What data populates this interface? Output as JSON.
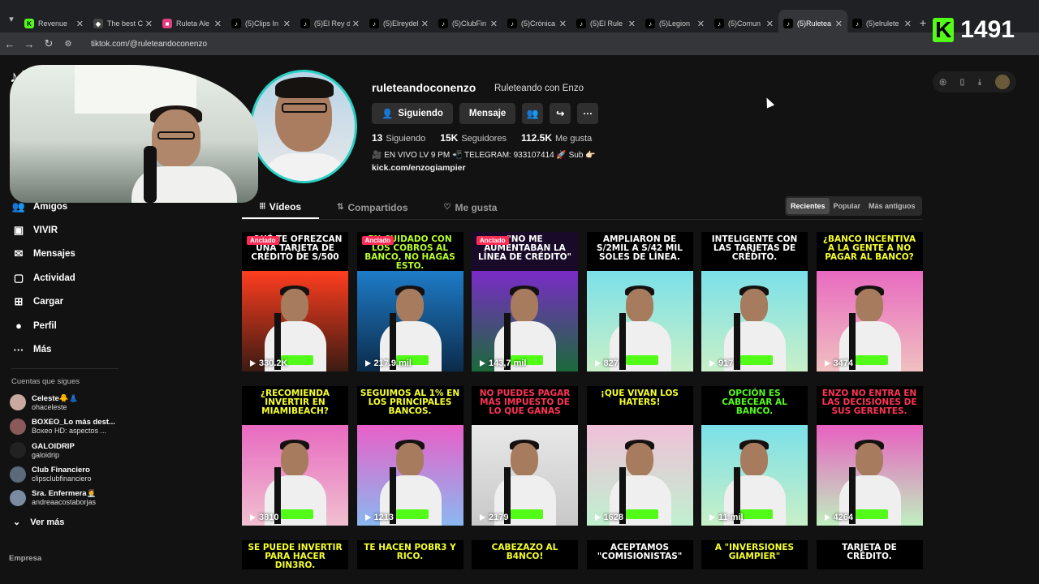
{
  "browser": {
    "tabs": [
      {
        "title": "Revenue",
        "fav_color": "#53fc18",
        "fav_text": "K",
        "active": false
      },
      {
        "title": "The best C",
        "fav_color": "#444",
        "fav_text": "◆",
        "active": false
      },
      {
        "title": "Ruleta Ale",
        "fav_color": "#e04080",
        "fav_text": "■",
        "active": false
      },
      {
        "title": "(5)Clips In",
        "fav_color": "#000",
        "fav_text": "♪",
        "active": false
      },
      {
        "title": "(5)El Rey d",
        "fav_color": "#000",
        "fav_text": "♪",
        "active": false
      },
      {
        "title": "(5)Elreydel",
        "fav_color": "#000",
        "fav_text": "♪",
        "active": false
      },
      {
        "title": "(5)ClubFin",
        "fav_color": "#000",
        "fav_text": "♪",
        "active": false
      },
      {
        "title": "(5)Crónica",
        "fav_color": "#000",
        "fav_text": "♪",
        "active": false
      },
      {
        "title": "(5)El Rule",
        "fav_color": "#000",
        "fav_text": "♪",
        "active": false
      },
      {
        "title": "(5)Legion",
        "fav_color": "#000",
        "fav_text": "♪",
        "active": false
      },
      {
        "title": "(5)Comun",
        "fav_color": "#000",
        "fav_text": "♪",
        "active": false
      },
      {
        "title": "(5)Ruletea",
        "fav_color": "#000",
        "fav_text": "♪",
        "active": true
      },
      {
        "title": "(5)elrulete",
        "fav_color": "#000",
        "fav_text": "♪",
        "active": false
      }
    ],
    "url": "tiktok.com/@ruleteandoconenzo"
  },
  "overlay": {
    "kick_letter": "K",
    "kick_count": "1491"
  },
  "sidebar": {
    "logo": "♪ T",
    "nav": [
      {
        "label": "Amigos",
        "icon": "👥"
      },
      {
        "label": "VIVIR",
        "icon": "▣"
      },
      {
        "label": "Mensajes",
        "icon": "✉"
      },
      {
        "label": "Actividad",
        "icon": "▢"
      },
      {
        "label": "Cargar",
        "icon": "⊞"
      },
      {
        "label": "Perfil",
        "icon": "●"
      },
      {
        "label": "Más",
        "icon": "···"
      }
    ],
    "following_title": "Cuentas que sigues",
    "following": [
      {
        "name": "Celeste🐥👗",
        "handle": "ohaceleste",
        "color": "#c9a9a0"
      },
      {
        "name": "BOXEO_Lo más dest...",
        "handle": "Boxeo HD: aspectos ...",
        "color": "#8a5a5a"
      },
      {
        "name": "GALOIDRIP",
        "handle": "galoidrip",
        "color": "#222"
      },
      {
        "name": "Club Financiero",
        "handle": "clipsclubfinanciero",
        "color": "#5a6a7a"
      },
      {
        "name": "Sra. Enfermera👩‍⚕️",
        "handle": "andreaacostaborjas",
        "color": "#7a8aa0"
      }
    ],
    "see_more": "Ver más",
    "footer": "Empresa"
  },
  "profile": {
    "username": "ruleteandoconenzo",
    "nickname": "Ruleteando con Enzo",
    "buttons": {
      "following": "Siguiendo",
      "message": "Mensaje"
    },
    "stats": [
      {
        "value": "13",
        "label": "Siguiendo"
      },
      {
        "value": "15K",
        "label": "Seguidores"
      },
      {
        "value": "112.5K",
        "label": "Me gusta"
      }
    ],
    "bio": "🎥 EN VIVO LV 9 PM 📲 TELEGRAM: 933107414 🚀 Sub 👉🏻",
    "link": "kick.com/enzogiampier"
  },
  "content_tabs": [
    {
      "label": "Vídeos",
      "icon": "⦙⦙⦙",
      "active": true
    },
    {
      "label": "Compartidos",
      "icon": "⇅",
      "active": false
    },
    {
      "label": "Me gusta",
      "icon": "♡",
      "active": false
    }
  ],
  "sort_options": [
    {
      "label": "Recientes",
      "active": true
    },
    {
      "label": "Popular",
      "active": false
    },
    {
      "label": "Más antiguos",
      "active": false
    }
  ],
  "pinned_label": "Anclado",
  "videos": [
    {
      "caption": "¿Qué te ofrezcan una tarjeta de crédito de S/500",
      "views": "330.2K",
      "pinned": true,
      "cap_bg": "#000",
      "cap_color": "#fff",
      "scene_bg": "linear-gradient(180deg,#ff3d1f,#3b1b12)"
    },
    {
      "caption": "En cuidado con los cobros al banco, no hagas esto.",
      "views": "217.9 mil",
      "pinned": true,
      "cap_bg": "#000",
      "cap_color": "#b6ff2a",
      "scene_bg": "linear-gradient(180deg,#1e7cc8,#0b2b4a)"
    },
    {
      "caption": "\"No me aumentaban la línea de crédito\"",
      "views": "143,7 mil",
      "pinned": true,
      "cap_bg": "#1a0a2a",
      "cap_color": "#fff",
      "scene_bg": "linear-gradient(180deg,#7a2bc8,#1b6a3a)"
    },
    {
      "caption": "Ampliaron de S/2mil a S/42 mil soles de línea.",
      "views": "827",
      "pinned": false,
      "cap_bg": "#000",
      "cap_color": "#fff",
      "scene_bg": "linear-gradient(180deg,#7be0e8,#c8f0c8)"
    },
    {
      "caption": "Inteligente con las tarjetas de crédito.",
      "views": "917",
      "pinned": false,
      "cap_bg": "#000",
      "cap_color": "#fff",
      "scene_bg": "linear-gradient(180deg,#7be0e8,#c8f0c8)"
    },
    {
      "caption": "¿Banco incentiva a la gente a no pagar al banco?",
      "views": "3474",
      "pinned": false,
      "cap_bg": "#000",
      "cap_color": "#f5ff2a",
      "scene_bg": "linear-gradient(180deg,#e86ac0,#f0c0c0)"
    },
    {
      "caption": "¿Recomienda invertir en Miamibeach?",
      "views": "3810",
      "pinned": false,
      "cap_bg": "#000",
      "cap_color": "#f5ff2a",
      "scene_bg": "linear-gradient(180deg,#e86ac0,#f0c0d0)"
    },
    {
      "caption": "Seguimos al 1% en los principales bancos.",
      "views": "1213",
      "pinned": false,
      "cap_bg": "#000",
      "cap_color": "#f5ff2a",
      "scene_bg": "linear-gradient(180deg,#e860c8,#8ab8f0)"
    },
    {
      "caption": "No puedes pagar más impuesto de lo que ganas",
      "views": "2179",
      "pinned": false,
      "cap_bg": "#000",
      "cap_color": "#ff3355",
      "scene_bg": "linear-gradient(180deg,#e8e8e8,#c8c8c8)"
    },
    {
      "caption": "¡Que vivan los haters!",
      "views": "1628",
      "pinned": false,
      "cap_bg": "#000",
      "cap_color": "#f5ff2a",
      "scene_bg": "linear-gradient(180deg,#f0c0d8,#c0f0d0)"
    },
    {
      "caption": "Opción es cabecear al banco.",
      "views": "11 mil",
      "pinned": false,
      "cap_bg": "#000",
      "cap_color": "#53fc18",
      "scene_bg": "linear-gradient(180deg,#7be0e8,#c8f0c8)"
    },
    {
      "caption": "Enzo no entra en las decisiones de sus gerentes.",
      "views": "4264",
      "pinned": false,
      "cap_bg": "#000",
      "cap_color": "#ff3355",
      "scene_bg": "linear-gradient(180deg,#e860c0,#c0f0c0)"
    },
    {
      "caption": "Se puede invertir para hacer din3ro.",
      "views": "",
      "pinned": false,
      "cap_bg": "#000",
      "cap_color": "#f5ff2a",
      "scene_bg": "#000"
    },
    {
      "caption": "Te hacen pobr3 y rico.",
      "views": "",
      "pinned": false,
      "cap_bg": "#000",
      "cap_color": "#f5ff2a",
      "scene_bg": "#000"
    },
    {
      "caption": "Cabezazo al b4nco!",
      "views": "",
      "pinned": false,
      "cap_bg": "#000",
      "cap_color": "#f5ff2a",
      "scene_bg": "#000"
    },
    {
      "caption": "Aceptamos \"comisionistas\"",
      "views": "",
      "pinned": false,
      "cap_bg": "#000",
      "cap_color": "#fff",
      "scene_bg": "#000"
    },
    {
      "caption": "A \"inversiones Giampier\"",
      "views": "",
      "pinned": false,
      "cap_bg": "#000",
      "cap_color": "#f5ff2a",
      "scene_bg": "#000"
    },
    {
      "caption": "Tarjeta de crédito.",
      "views": "",
      "pinned": false,
      "cap_bg": "#000",
      "cap_color": "#fff",
      "scene_bg": "#000"
    }
  ]
}
